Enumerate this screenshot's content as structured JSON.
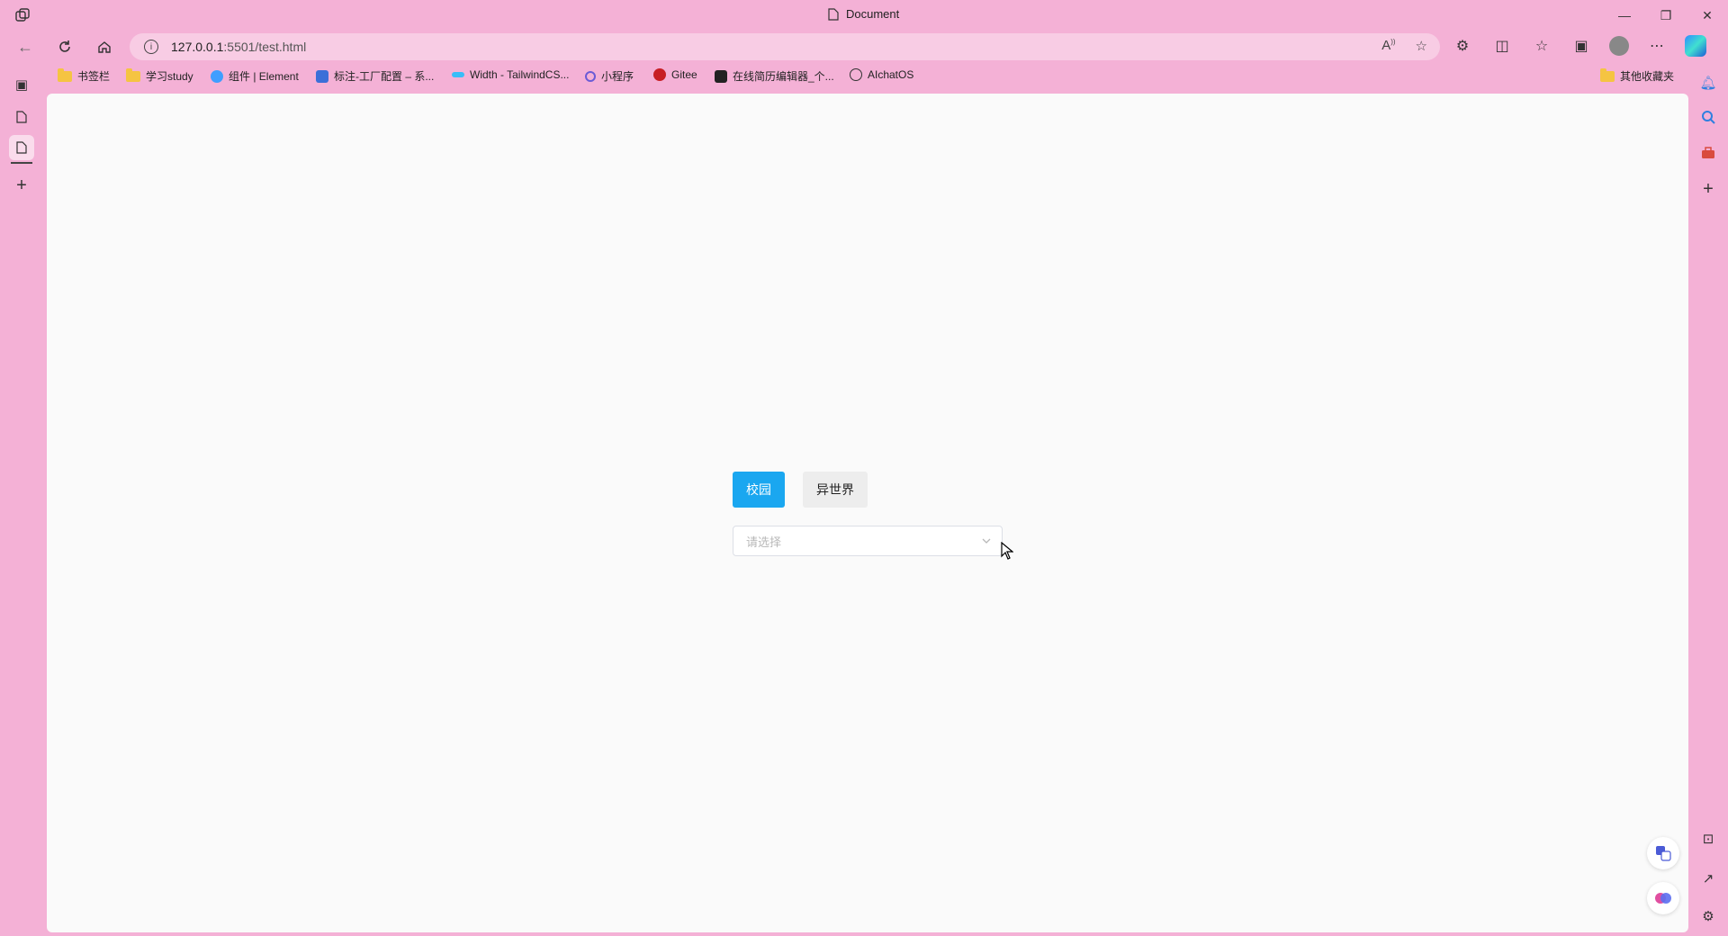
{
  "window": {
    "tab_title": "Document",
    "controls": [
      "—",
      "❐",
      "✕"
    ]
  },
  "navbar": {
    "url_host": "127.0.0.1",
    "url_path": ":5501/test.html"
  },
  "bookmarks": [
    {
      "label": "书签栏",
      "icon": "folder-icon"
    },
    {
      "label": "学习study",
      "icon": "folder-icon"
    },
    {
      "label": "组件 | Element",
      "icon": "element-icon"
    },
    {
      "label": "标注-工厂配置 – 系...",
      "icon": "label-icon"
    },
    {
      "label": "Width - TailwindCS...",
      "icon": "tailwind-icon"
    },
    {
      "label": "小程序",
      "icon": "link-icon"
    },
    {
      "label": "Gitee",
      "icon": "gitee-icon"
    },
    {
      "label": "在线简历编辑器_个...",
      "icon": "resume-icon"
    },
    {
      "label": "AIchatOS",
      "icon": "openai-icon"
    }
  ],
  "other_bookmarks": "其他收藏夹",
  "page": {
    "button_campus": "校园",
    "button_otherworld": "异世界",
    "select_placeholder": "请选择"
  },
  "colors": {
    "primary": "#1aa7f0",
    "browser_bg": "#f4b1d6"
  }
}
